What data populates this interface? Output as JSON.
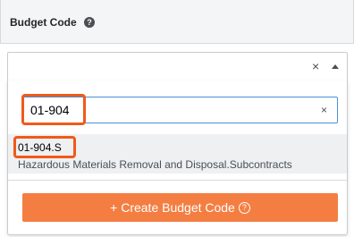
{
  "header": {
    "label": "Budget Code",
    "help_icon": "?"
  },
  "select": {
    "value": "",
    "clear_icon": "×"
  },
  "search": {
    "value": "01-904",
    "clear_icon": "×"
  },
  "results": [
    {
      "code": "01-904.S",
      "description": "Hazardous Materials Removal and Disposal.Subcontracts"
    }
  ],
  "create_button": {
    "label": "+ Create Budget Code",
    "help_icon": "?"
  },
  "colors": {
    "accent": "#f47e42",
    "highlight": "#f05a1a",
    "focus": "#4a90d9"
  }
}
